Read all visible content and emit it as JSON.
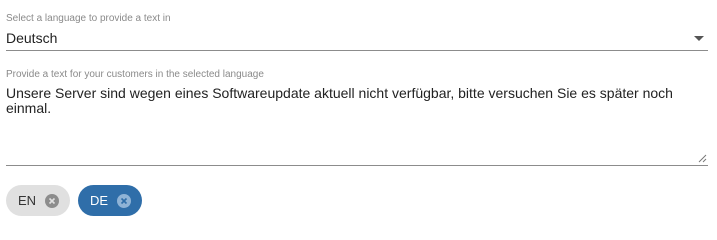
{
  "language_select": {
    "label": "Select a language to provide a text in",
    "value": "Deutsch",
    "arrow_icon": "dropdown-arrow-icon"
  },
  "text_field": {
    "label": "Provide a text for your customers in the selected language",
    "value": "Unsere Server sind wegen eines Softwareupdate aktuell nicht verfügbar, bitte versuchen Sie es später noch einmal."
  },
  "language_chips": [
    {
      "label": "EN",
      "selected": false,
      "close_icon": "close-circle-icon"
    },
    {
      "label": "DE",
      "selected": true,
      "close_icon": "close-circle-icon"
    }
  ],
  "colors": {
    "selected_chip": "#2f6ea9",
    "unselected_chip": "#e0e0e0",
    "label_text": "#8a8a8a"
  }
}
